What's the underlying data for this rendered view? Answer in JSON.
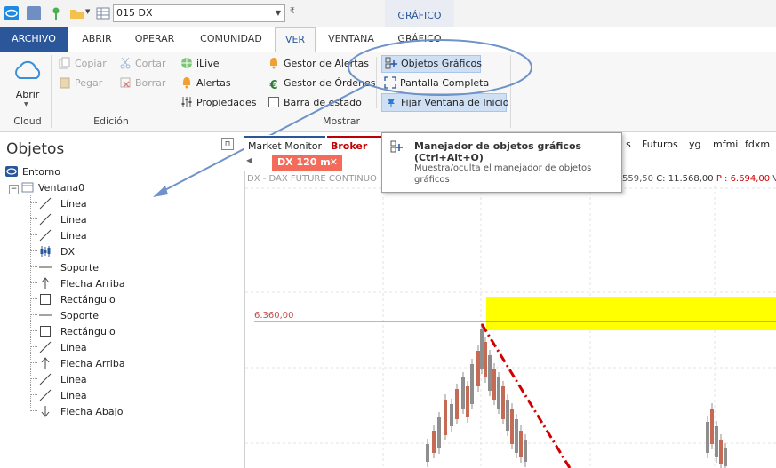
{
  "colors": {
    "accent": "#2b579a",
    "highlight": "#cfe0f4",
    "yellow_zone": "#ffff00",
    "level_line": "#c0504d",
    "trend_line": "#d00000"
  },
  "qat": {
    "symbol_value": "015 DX"
  },
  "context_tab": {
    "label": "GRÁFICO"
  },
  "tabs": [
    "ARCHIVO",
    "ABRIR",
    "OPERAR",
    "COMUNIDAD",
    "VER",
    "VENTANA",
    "GRÁFICO"
  ],
  "ribbon": {
    "cloud": {
      "open_label": "Abrir",
      "group": "Cloud"
    },
    "edicion": {
      "copiar": "Copiar",
      "pegar": "Pegar",
      "cortar": "Cortar",
      "borrar": "Borrar",
      "group": "Edición"
    },
    "mostrar": {
      "ilive": "iLive",
      "alertas": "Alertas",
      "propiedades": "Propiedades",
      "gestor_alertas": "Gestor de Alertas",
      "gestor_ordenes": "Gestor de Órdenes",
      "barra_estado": "Barra de estado",
      "objetos_graficos": "Objetos Gráficos",
      "pantalla_completa": "Pantalla Completa",
      "fijar_ventana": "Fijar Ventana de Inicio",
      "group": "Mostrar"
    }
  },
  "tooltip": {
    "title": "Manejador de objetos gráficos (Ctrl+Alt+O)",
    "body": "Muestra/oculta el manejador de objetos gráficos"
  },
  "panel": {
    "title": "Objetos",
    "root": "Entorno",
    "window": "Ventana0",
    "items": [
      {
        "label": "Línea",
        "icon": "line-icon"
      },
      {
        "label": "Línea",
        "icon": "line-icon"
      },
      {
        "label": "Línea",
        "icon": "line-icon"
      },
      {
        "label": "DX",
        "icon": "candles-icon"
      },
      {
        "label": "Soporte",
        "icon": "hline-icon"
      },
      {
        "label": "Flecha Arriba",
        "icon": "arrow-up-icon"
      },
      {
        "label": "Rectángulo",
        "icon": "rectangle-icon"
      },
      {
        "label": "Soporte",
        "icon": "hline-icon"
      },
      {
        "label": "Rectángulo",
        "icon": "rectangle-icon"
      },
      {
        "label": "Línea",
        "icon": "line-icon"
      },
      {
        "label": "Flecha Arriba",
        "icon": "arrow-up-icon"
      },
      {
        "label": "Línea",
        "icon": "line-icon"
      },
      {
        "label": "Línea",
        "icon": "line-icon"
      },
      {
        "label": "Flecha Abajo",
        "icon": "arrow-down-icon"
      }
    ]
  },
  "chart_tabs": {
    "market_monitor": "Market Monitor",
    "broker": "Broker Dem",
    "right": [
      "s",
      "Futuros",
      "yg",
      "mfmi",
      "fdxm"
    ]
  },
  "chart_window": {
    "tab": "DX 120 m",
    "header_left": "DX - DAX FUTURE CONTINUO",
    "header_mid": "559,50",
    "header_c": "C: 11.568,00",
    "header_p": "P : 6.694,00",
    "header_v": "V",
    "level_label": "6.360,00"
  }
}
